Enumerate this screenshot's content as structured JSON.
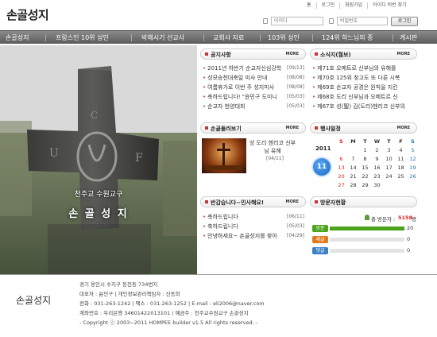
{
  "header": {
    "logo": "손골성지",
    "links": [
      "홈",
      "로그인",
      "회원가입",
      "아이디 비번 찾기"
    ],
    "id_label": "아이디",
    "pw_label": "비밀번호",
    "login_button": "로그인"
  },
  "nav": [
    "손골성지",
    "프랑스인 10위 성인",
    "박해시기 선교사",
    "교회사 자료",
    "103위 성인",
    "124위 하느님의 종",
    "게시판"
  ],
  "hero": {
    "subtitle": "천주교 수원교구",
    "title": "손 골 성 지"
  },
  "notice": {
    "title": "공지사항",
    "more": "MORE",
    "items": [
      {
        "text": "2011년 하반기 순교자신심강학",
        "date": "[09/13]"
      },
      {
        "text": "성모승천대축일 미사 안내",
        "date": "[08/08]"
      },
      {
        "text": "여름휴가로 이번 주 성지미사",
        "date": "[08/08]"
      },
      {
        "text": "축하드립니다! \"윤민구 도미니",
        "date": "[05/03]"
      },
      {
        "text": "순교자 현양대회",
        "date": "[05/03]"
      }
    ]
  },
  "news": {
    "title": "소식지(월보)",
    "more": "MORE",
    "items": [
      "제71호 오메트르 신부님의 유해를",
      "제70호 125위 찾고도 또 다른 시복",
      "제69호 순교자 공경은 원칙을 지킨",
      "제68호 도리 신부님과 오메트르 신",
      "제67호 성(聖) 김(도리)헨리코 신부의"
    ]
  },
  "tour": {
    "title": "손골둘러보기",
    "more": "MORE",
    "caption": "성 도리 헨리코 신부님 유해",
    "date": "[04/11]"
  },
  "events": {
    "title": "행사일정",
    "more": "MORE",
    "year": "2011",
    "month": "11",
    "weekdays": [
      "S",
      "M",
      "T",
      "W",
      "T",
      "F",
      "S"
    ],
    "weeks": [
      [
        "",
        "",
        "1",
        "2",
        "3",
        "4",
        "5"
      ],
      [
        "6",
        "7",
        "8",
        "9",
        "10",
        "11",
        "12"
      ],
      [
        "13",
        "14",
        "15",
        "16",
        "17",
        "18",
        "19"
      ],
      [
        "20",
        "21",
        "22",
        "23",
        "24",
        "25",
        "26"
      ],
      [
        "27",
        "28",
        "29",
        "30",
        "",
        "",
        ""
      ]
    ]
  },
  "greetings": {
    "title": "반갑습니다~인사해요!",
    "more": "MORE",
    "items": [
      {
        "text": "축하드립니다",
        "date": "[06/11]"
      },
      {
        "text": "축하드립니다",
        "date": "[05/03]"
      },
      {
        "text": "안녕하세요~ 손골성지를 찾아",
        "date": "[04/29]"
      }
    ]
  },
  "visitors": {
    "title": "방문자현황",
    "total_label": "총 방문자 :",
    "total": "5158",
    "total_unit": "명",
    "rows": [
      {
        "label": "방문",
        "value": "20",
        "fraction": 1.0,
        "color": "#4ca31c"
      },
      {
        "label": "새글",
        "value": "0",
        "fraction": 0.0,
        "color": "#e07a1f"
      },
      {
        "label": "댓글",
        "value": "0",
        "fraction": 0.0,
        "color": "#3b7fc4"
      }
    ]
  },
  "footer": {
    "logo": "손골성지",
    "lines": [
      "경기 용인시 수지구 동천동 734번지",
      "대표자 : 윤민구  |  개인정보관리책임자 : 신동희",
      "전화 : 031-263-1242  |  팩스 : 031-263-1252  |  E-mail : eli2006@naver.com",
      "계좌번호 : 우리은행 34601422013101 / 예금주 : 천주교수원교구 손골성지",
      "- Copyright ⓒ 2003~2011 HOMPEE builder v1.5 All rights reserved. -"
    ]
  }
}
